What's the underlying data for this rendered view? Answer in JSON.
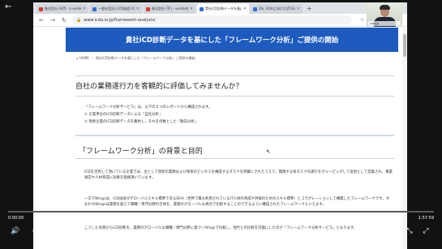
{
  "player": {
    "back_icon": "back-arrow-icon",
    "time_current": "0:00:00",
    "time_total": "1:57:59",
    "progress": 0.0
  },
  "browser": {
    "tabs": [
      {
        "label": "株式会社 iAZ5 - a vendor-iO...",
        "active": false
      },
      {
        "label": "一般社団法人iCD協会 iCD...",
        "active": false
      },
      {
        "label": "株式会社 (TF) - vendor総...",
        "active": false
      },
      {
        "label": "貴社iCD診断データを基にした...",
        "active": true
      },
      {
        "label": "Zik, 41年に向けた(JTGS)iC...",
        "active": false
      }
    ],
    "address": "www.icda.or.jp/framework-analysis/"
  },
  "page": {
    "hero_title": "貴社iCD診断データを基にした「フレームワーク分析」ご提供の開始",
    "breadcrumb": {
      "home": "HOME",
      "current": "貴社iCD診断データを基にした「フレームワーク分析」ご提供の開始"
    },
    "section1": {
      "heading": "自社の業務遂行力を客観的に評価してみませんか？",
      "lines": [
        "「フレームワーク分析サービス」は、以下の２つのレポートから構成されます。",
        "① 企業単位のiCD診断データによる「自社分析」",
        "② 現状企業のiCD診断データを集約し、それを母数とした「動向分析」"
      ]
    },
    "section2": {
      "heading": "「フレームワーク分析」の背景と目的",
      "para1": "iCDを活用して頂いている企業では、主として現状の業務および将来のビジネスを構成するタスクを明確にされたうえで、関連する各タスクの遂行をグルーピングして役割として定義され、事業運営や人材育成に効果を発揮頂いています。",
      "para2": "一方でWingsは、iCD協会がグローバルスキル標準であるSFIA（世界で最も利用されているIT人材の育成や評価のためのスキル標準）とコラボレーションして構築したフレームワークです。すなわちWingsは業態を超えて職種／専門分野の全体を、業務のグローバルな視点で比較することのできるように構成されたフレームワークといえます。",
      "para3": "こうした背景からiCD診断を、業務のグローバルな職種／専門分野に基づくWingsで比較し、他社との比較を可能にしたのが「フレームワーク分析サービス」となります。"
    }
  },
  "webcam": {
    "name_tag": "iCD協会"
  }
}
